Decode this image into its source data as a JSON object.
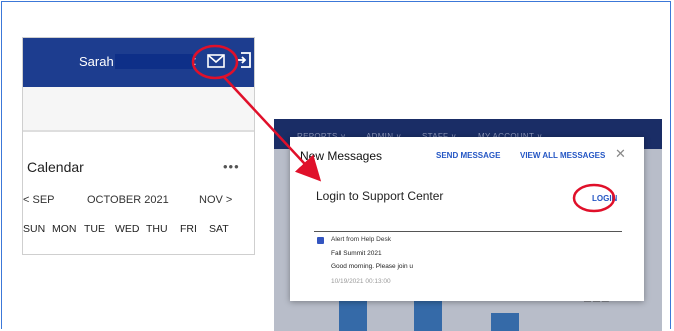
{
  "left_screen": {
    "user_name": "Sarah",
    "calendar_title": "Calendar",
    "more_menu": "•••",
    "prev_month": "< SEP",
    "current_month": "OCTOBER  2021",
    "next_month": "NOV >",
    "weekdays": [
      "SUN",
      "MON",
      "TUE",
      "WED",
      "THU",
      "FRI",
      "SAT"
    ]
  },
  "right_screen": {
    "nav_items": [
      "REPORTS ∨",
      "ADMIN ∨",
      "STAFF ∨",
      "MY ACCOUNT ∨"
    ],
    "modal": {
      "title": "New Messages",
      "send_message": "SEND MESSAGE",
      "view_all": "VIEW ALL MESSAGES",
      "close": "✕",
      "support_text": "Login to Support Center",
      "login": "LOGIN",
      "message": {
        "from": "Alert from Help Desk",
        "subject": "Fall Summit 2021",
        "body": "Good morning. Please join u",
        "timestamp": "10/19/2021 00:13:00"
      }
    }
  },
  "colors": {
    "nav_blue": "#1d3d8f",
    "link_blue": "#2456c4",
    "annotation_red": "#e0102a",
    "frame_blue": "#3c78d8"
  },
  "icons": [
    "mail-icon",
    "logout-icon",
    "checkbox-icon",
    "close-icon"
  ]
}
